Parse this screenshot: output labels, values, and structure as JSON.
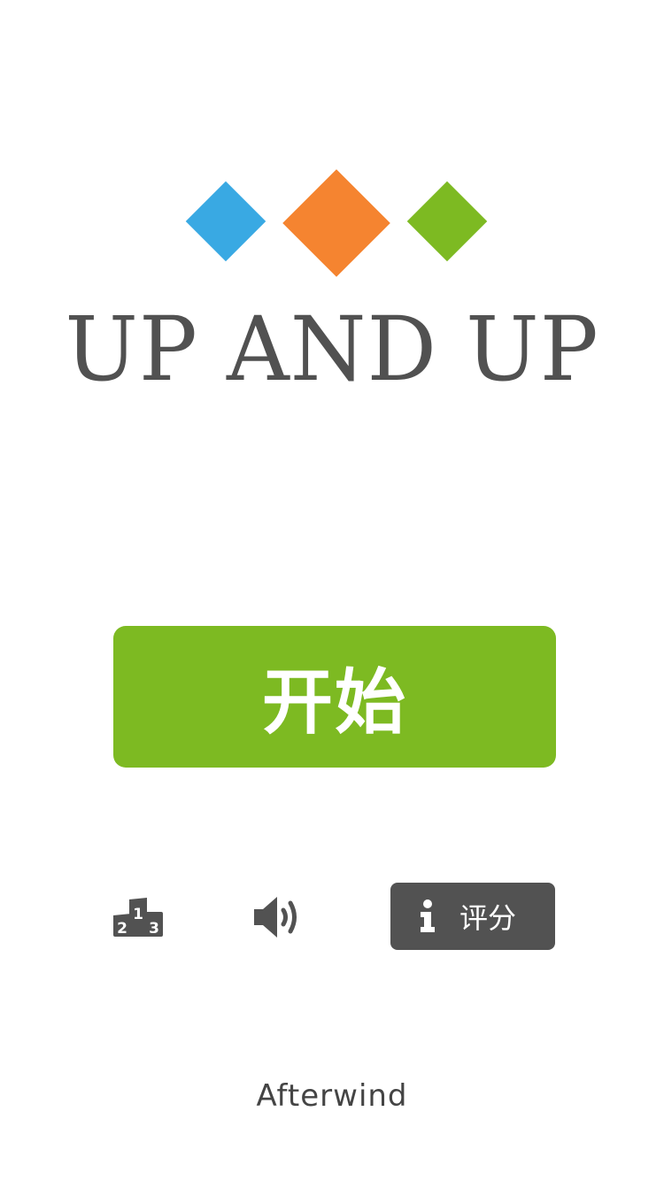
{
  "colors": {
    "blue": "#39a9e3",
    "orange": "#f58430",
    "green": "#7dba22",
    "dark": "#525252",
    "text": "#515151"
  },
  "logo": {
    "icons": [
      "blue-diamond",
      "orange-diamond",
      "green-diamond"
    ],
    "title": "UP AND UP"
  },
  "menu": {
    "start_label": "开始",
    "leaderboard_icon": "podium-icon",
    "leaderboard_digits": [
      "2",
      "1",
      "3"
    ],
    "sound_icon": "speaker-icon",
    "rate_icon": "info-icon",
    "rate_label": "评分"
  },
  "footer": {
    "developer": "Afterwind"
  }
}
